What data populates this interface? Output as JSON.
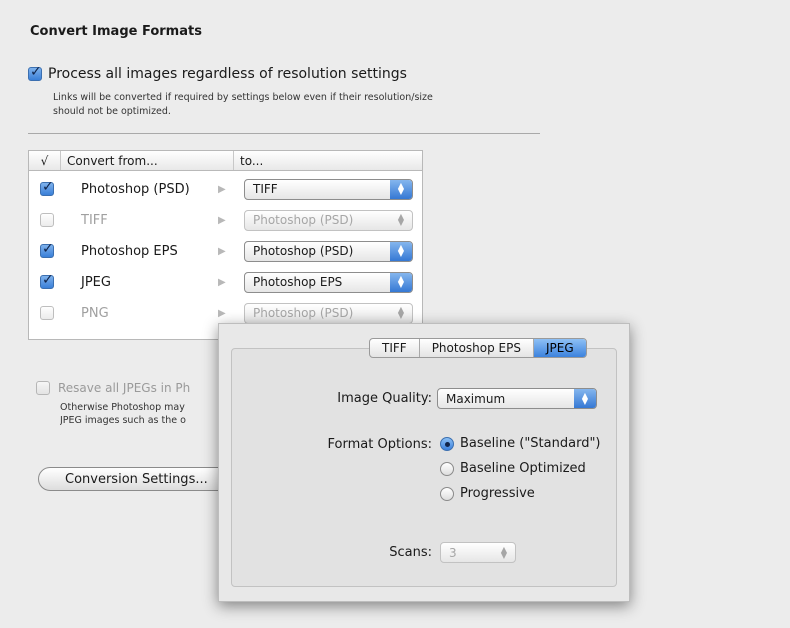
{
  "section": {
    "title": "Convert Image Formats"
  },
  "process_all": {
    "label": "Process all images regardless of resolution settings",
    "checked": true,
    "note": "Links will be converted if required by settings below even if their resolution/size should not be optimized."
  },
  "conversion_table": {
    "headers": {
      "check": "√",
      "from": "Convert from...",
      "to": "to..."
    },
    "rows": [
      {
        "from": "Photoshop (PSD)",
        "to": "TIFF",
        "checked": true,
        "enabled": true
      },
      {
        "from": "TIFF",
        "to": "Photoshop (PSD)",
        "checked": false,
        "enabled": false
      },
      {
        "from": "Photoshop EPS",
        "to": "Photoshop (PSD)",
        "checked": true,
        "enabled": true
      },
      {
        "from": "JPEG",
        "to": "Photoshop EPS",
        "checked": true,
        "enabled": true
      },
      {
        "from": "PNG",
        "to": "Photoshop (PSD)",
        "checked": false,
        "enabled": false
      }
    ]
  },
  "resave": {
    "label": "Resave all JPEGs in Ph",
    "note_line1": "Otherwise Photoshop may",
    "note_line2": "JPEG images such as the o"
  },
  "conversion_settings_button": {
    "label": "Conversion Settings..."
  },
  "sheet": {
    "tabs": [
      {
        "label": "TIFF",
        "active": false
      },
      {
        "label": "Photoshop EPS",
        "active": false
      },
      {
        "label": "JPEG",
        "active": true
      }
    ],
    "image_quality": {
      "label": "Image Quality:",
      "value": "Maximum"
    },
    "format_options": {
      "label": "Format Options:",
      "options": [
        {
          "label": "Baseline (\"Standard\")",
          "selected": true
        },
        {
          "label": "Baseline Optimized",
          "selected": false
        },
        {
          "label": "Progressive",
          "selected": false
        }
      ]
    },
    "scans": {
      "label": "Scans:",
      "value": "3",
      "enabled": false
    }
  },
  "colors": {
    "accent": "#3b80dc",
    "background": "#ececec"
  }
}
